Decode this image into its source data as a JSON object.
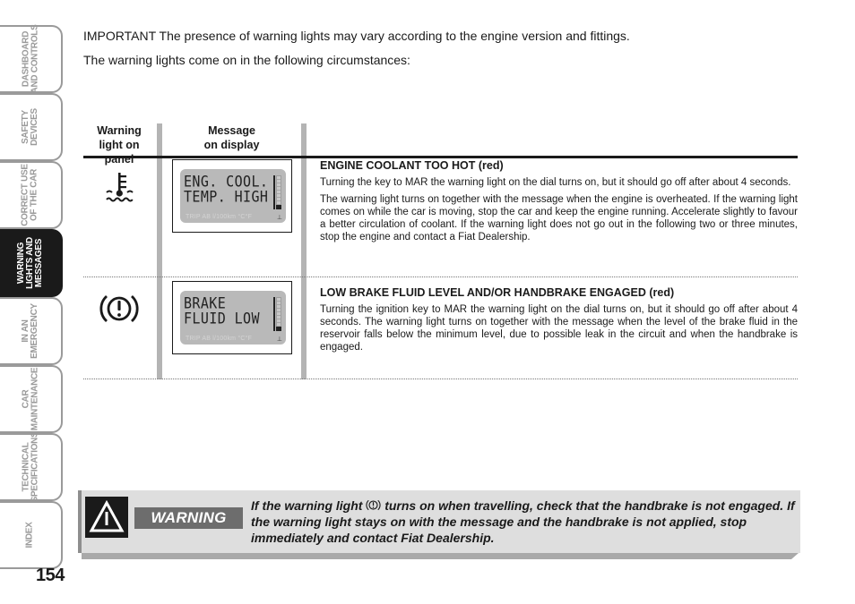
{
  "sidebar": {
    "tabs": [
      {
        "lines": [
          "DASHBOARD",
          "AND CONTROLS"
        ],
        "active": false
      },
      {
        "lines": [
          "SAFETY",
          "DEVICES"
        ],
        "active": false
      },
      {
        "lines": [
          "CORRECT USE",
          "OF THE CAR"
        ],
        "active": false
      },
      {
        "lines": [
          "WARNING",
          "LIGHTS AND",
          "MESSAGES"
        ],
        "active": true
      },
      {
        "lines": [
          "IN AN",
          "EMERGENCY"
        ],
        "active": false
      },
      {
        "lines": [
          "CAR",
          "MAINTENANCE"
        ],
        "active": false
      },
      {
        "lines": [
          "TECHNICAL",
          "SPECIFICATIONS"
        ],
        "active": false
      },
      {
        "lines": [
          "INDEX"
        ],
        "active": false
      }
    ]
  },
  "page_number": "154",
  "intro": {
    "important": "IMPORTANT The presence of warning lights may vary according to the engine version and fittings.",
    "lead": "The warning lights come on in the following circumstances:"
  },
  "table": {
    "headers": {
      "warning_light": [
        "Warning",
        "light on panel"
      ],
      "message": [
        "Message",
        "on display"
      ]
    },
    "rows": [
      {
        "icon": "coolant-temperature-icon",
        "display": {
          "line1": "ENG. COOL.",
          "line2": "TEMP. HIGH",
          "footer": "TRIP AB l/100km °C°F"
        },
        "title": "ENGINE COOLANT TOO HOT (red)",
        "paragraphs": [
          "Turning the key to MAR the warning light on the dial turns on, but it should go off after about 4 seconds.",
          "The warning light turns on together with the message when the engine is overheated. If the warning light comes on while the car is moving, stop the car and keep the engine running. Accelerate slightly to favour a better circulation of coolant. If the warning light does not go out in the following two or three minutes, stop the engine and contact a Fiat Dealership."
        ]
      },
      {
        "icon": "brake-warning-icon",
        "display": {
          "line1": "BRAKE",
          "line2": "FLUID LOW",
          "footer": "TRIP AB l/100km °C°F"
        },
        "title": "LOW BRAKE FLUID LEVEL AND/OR HANDBRAKE ENGAGED (red)",
        "paragraphs": [
          "Turning the ignition key to MAR the warning light on the dial turns on, but it should go off after about 4 seconds. The warning light turns on together with the message when the level of the brake fluid in the reservoir falls below the minimum level, due to possible leak in the circuit and when the handbrake is engaged."
        ]
      }
    ]
  },
  "warning_box": {
    "label": "WARNING",
    "text_before_icon": "If the warning light ",
    "text_after_icon": " turns on when travelling, check that the handbrake is not engaged. If the warning light stays on with the message and the handbrake is not applied, stop immediately and contact Fiat Dealership."
  }
}
